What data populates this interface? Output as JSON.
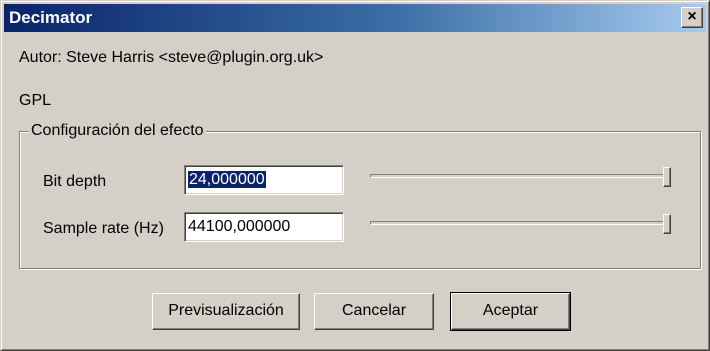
{
  "window": {
    "title": "Decimator",
    "close_label": "×"
  },
  "info": {
    "author": "Autor: Steve Harris <steve@plugin.org.uk>",
    "license": "GPL"
  },
  "group": {
    "title": "Configuración del efecto",
    "params": [
      {
        "label": "Bit depth",
        "value": "24,000000",
        "slider_fraction": 1.0
      },
      {
        "label": "Sample rate (Hz)",
        "value": "44100,000000",
        "slider_fraction": 1.0
      }
    ]
  },
  "buttons": {
    "preview": "Previsualización",
    "cancel": "Cancelar",
    "accept": "Aceptar"
  }
}
